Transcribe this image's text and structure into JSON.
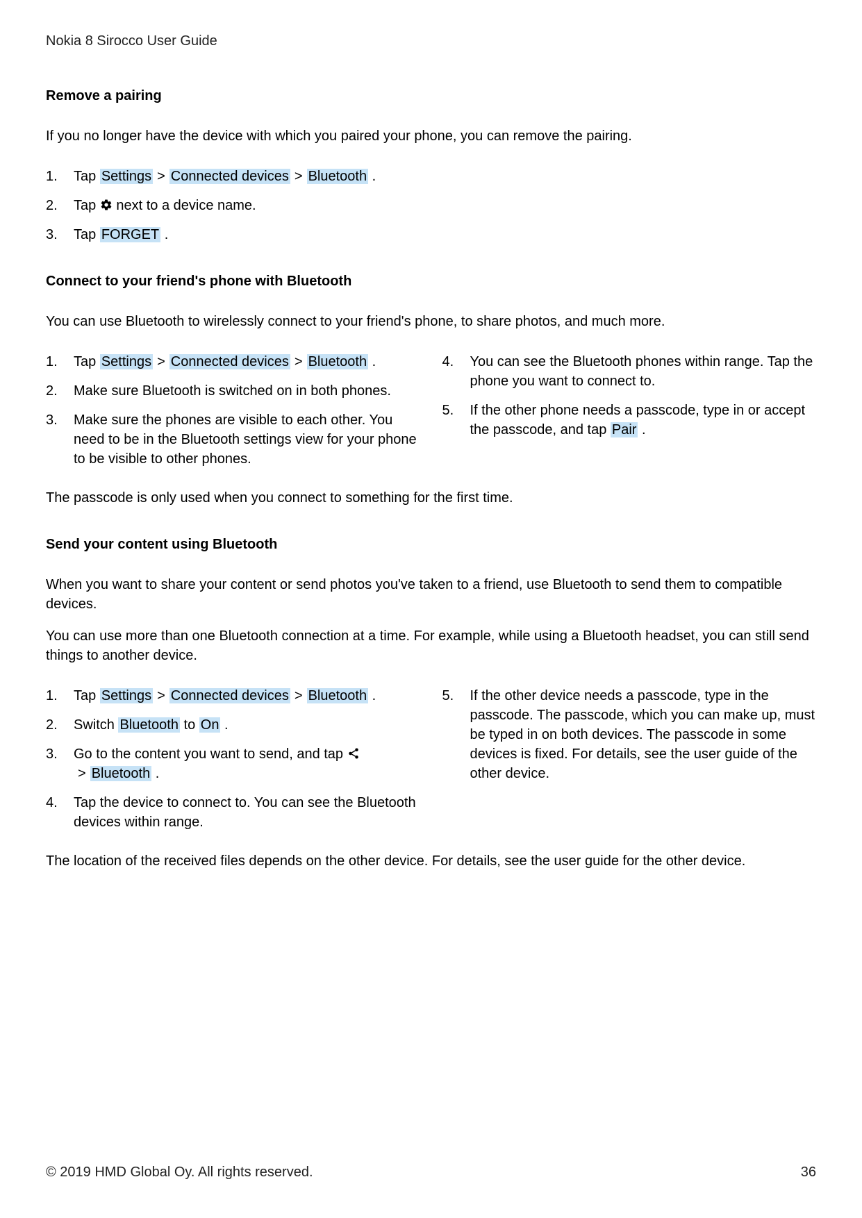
{
  "doc_title": "Nokia 8 Sirocco User Guide",
  "s1": {
    "heading": "Remove a pairing",
    "intro": "If you no longer have the device with which you paired your phone, you can remove the pairing.",
    "steps": {
      "s1_pre": "Tap ",
      "s1_hl_settings": "Settings",
      "s1_hl_connected": "Connected devices",
      "s1_hl_bluetooth": "Bluetooth",
      "s2_pre": "Tap ",
      "s2_post": " next to a device name.",
      "s3_pre": "Tap ",
      "s3_hl_forget": "FORGET"
    }
  },
  "s2": {
    "heading": "Connect to your friend's phone with Bluetooth",
    "intro": "You can use Bluetooth to wirelessly connect to your friend's phone, to share photos, and much more.",
    "steps": {
      "s1_pre": "Tap ",
      "s1_hl_settings": "Settings",
      "s1_hl_connected": "Connected devices",
      "s1_hl_bluetooth": "Bluetooth",
      "s2": "Make sure Bluetooth is switched on in both phones.",
      "s3": "Make sure the phones are visible to each other. You need to be in the Bluetooth settings view for your phone to be visible to other phones.",
      "s4": "You can see the Bluetooth phones within range. Tap the phone you want to connect to.",
      "s5_pre": "If the other phone needs a passcode, type in or accept the passcode, and tap ",
      "s5_hl_pair": "Pair"
    },
    "postnote": "The passcode is only used when you connect to something for the first time."
  },
  "s3": {
    "heading": "Send your content using Bluetooth",
    "intro1": "When you want to share your content or send photos you've taken to a friend, use Bluetooth to send them to compatible devices.",
    "intro2": "You can use more than one Bluetooth connection at a time. For example, while using a Bluetooth headset, you can still send things to another device.",
    "steps": {
      "s1_pre": "Tap ",
      "s1_hl_settings": "Settings",
      "s1_hl_connected": "Connected devices",
      "s1_hl_bluetooth": "Bluetooth",
      "s2_pre": "Switch ",
      "s2_hl_bluetooth": "Bluetooth",
      "s2_mid": " to ",
      "s2_hl_on": "On",
      "s3_pre": "Go to the content you want to send, and tap ",
      "s3_hl_bluetooth": "Bluetooth",
      "s4": "Tap the device to connect to. You can see the Bluetooth devices within range.",
      "s5": "If the other device needs a passcode, type in the passcode. The passcode, which you can make up, must be typed in on both devices. The passcode in some devices is fixed. For details, see the user guide of the other device."
    },
    "postnote": "The location of the received files depends on the other device. For details, see the user guide for the other device."
  },
  "footer": {
    "copyright": "© 2019 HMD Global Oy. All rights reserved.",
    "page": "36"
  },
  "glyph_sep": ">"
}
